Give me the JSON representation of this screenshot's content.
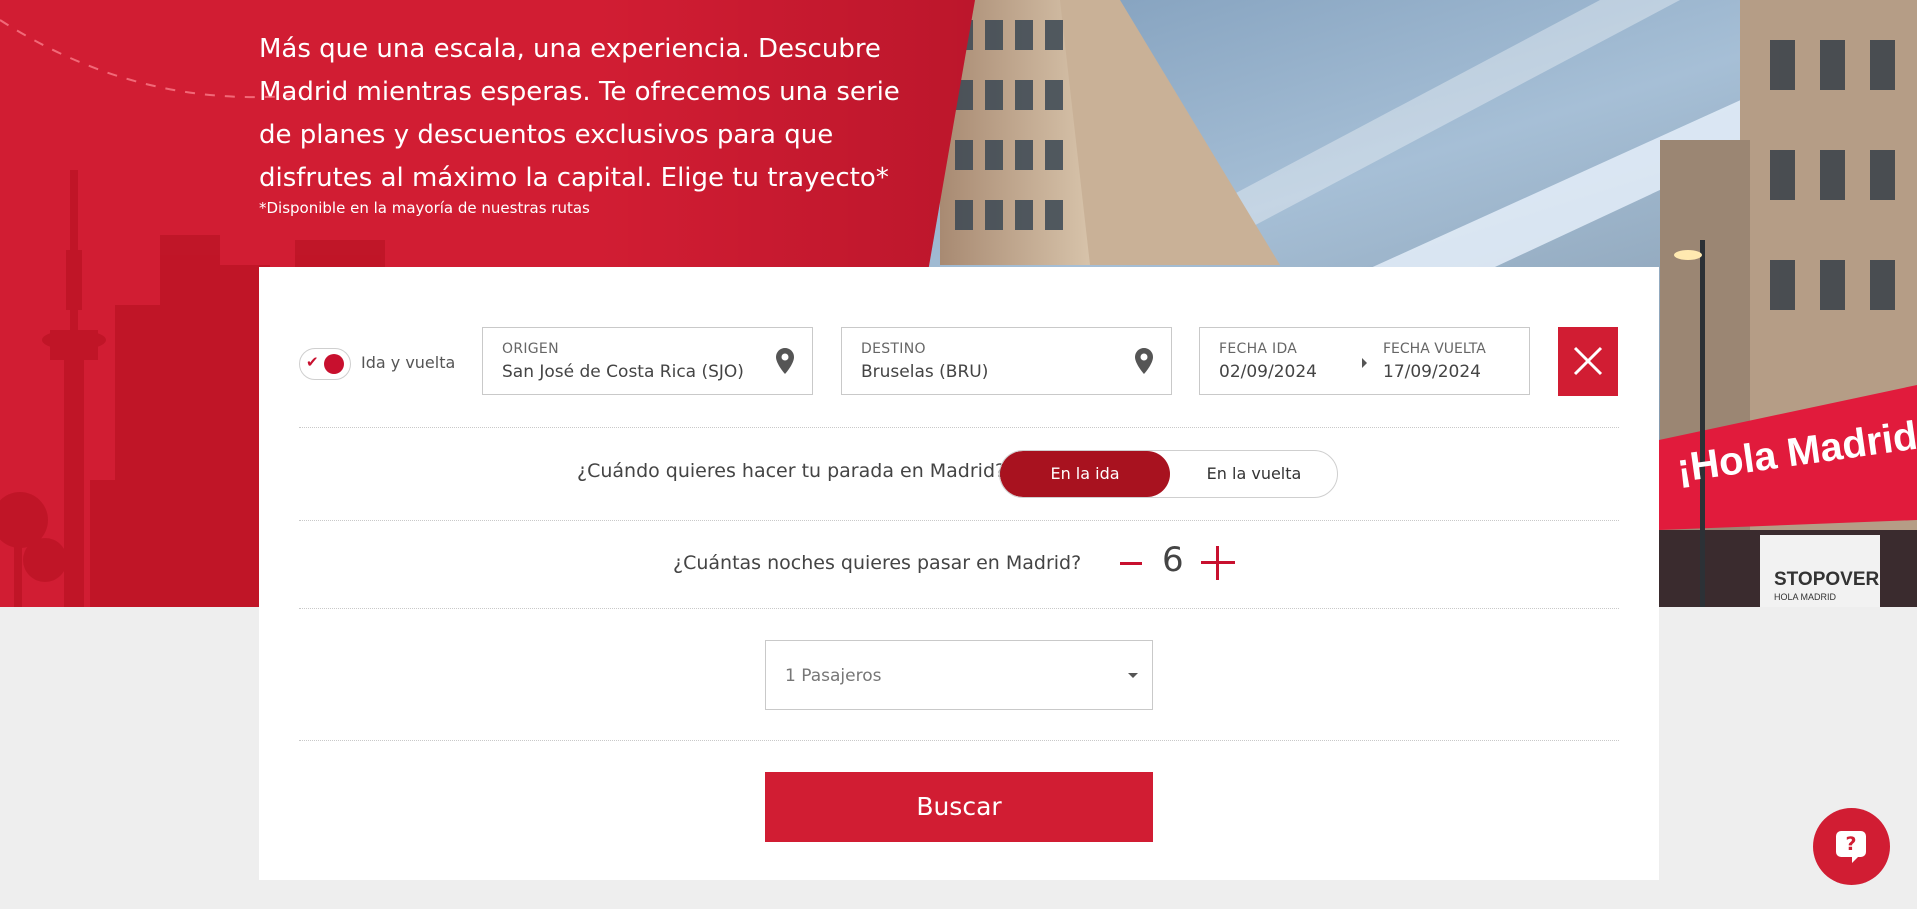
{
  "hero": {
    "text": "Más que una escala, una experiencia. Descubre Madrid mientras esperas. Te ofrecemos una serie de planes y descuentos exclusivos para que disfrutes al máximo la capital. Elige tu trayecto*",
    "note": "*Disponible en la mayoría de nuestras rutas",
    "sign_text": "¡Hola Madrid!",
    "logo_text": "STOPOVER",
    "logo_sub": "HOLA MADRID"
  },
  "search": {
    "trip_toggle_label": "Ida y vuelta",
    "origin_label": "ORIGEN",
    "origin_value": "San José de Costa Rica (SJO)",
    "destination_label": "DESTINO",
    "destination_value": "Bruselas (BRU)",
    "departure_label": "FECHA IDA",
    "departure_value": "02/09/2024",
    "return_label": "FECHA VUELTA",
    "return_value": "17/09/2024"
  },
  "stopover": {
    "question": "¿Cuándo quieres hacer tu parada en Madrid?",
    "option_outbound": "En la ida",
    "option_return": "En la vuelta",
    "selected": "En la ida"
  },
  "nights": {
    "question": "¿Cuántas noches quieres pasar en Madrid?",
    "value": "6"
  },
  "passengers": {
    "value": "1 Pasajeros"
  },
  "actions": {
    "search_label": "Buscar"
  },
  "colors": {
    "brand_red": "#d11d33",
    "selected_dark_red": "#a8121f"
  },
  "icons": [
    "check-icon",
    "location-pin-icon",
    "arrow-right-icon",
    "close-icon",
    "minus-icon",
    "plus-icon",
    "caret-down-icon",
    "help-chat-icon"
  ]
}
